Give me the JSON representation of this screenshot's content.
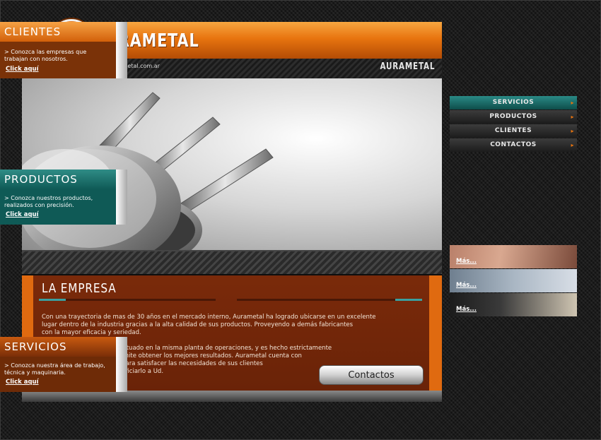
{
  "header": {
    "logo_letter": "A",
    "logo_text": "AURAMETAL",
    "url": "www.aurametal.com.ar",
    "brand_small": "AURAMETAL",
    "accent": "#e8740f"
  },
  "empresa": {
    "title": "LA EMPRESA",
    "para1": "Con una trayectoria de mas de 30 años en el mercado interno, Aurametal ha logrado ubicarse en un excelente\nlugar dentro de la industria gracias a la alta calidad de sus productos. Proveyendo a demás fabricantes\ncon la mayor eficacia y seriedad.",
    "para2": "El control de calidad es efectuado en la misma planta de operaciones, y es hecho estrictamente\npor sus dueños, lo cual permite obtener los mejores resultados. Aurametal cuenta con\nun personal especializado para satisfacer las necesidades de sus clientes\ny está preparada para beneficiarlo a Ud.\nen un futuro cercano.",
    "contact_button": "Contactos"
  },
  "sidebar": {
    "clientes": {
      "title": "CLIENTES",
      "text": "> Conozca las empresas que trabajan con nosotros.",
      "link": "Click aquí"
    },
    "nav": [
      {
        "label": "SERVICIOS",
        "active": true
      },
      {
        "label": "PRODUCTOS",
        "active": false
      },
      {
        "label": "CLIENTES",
        "active": false
      },
      {
        "label": "CONTACTOS",
        "active": false
      }
    ],
    "productos": {
      "title": "PRODUCTOS",
      "text": "> Conozca nuestros productos, realizados con precisión.",
      "link": "Click aquí"
    },
    "gallery": [
      "Más...",
      "Más...",
      "Más..."
    ],
    "servicios": {
      "title": "SERVICIOS",
      "text": "> Conozca nuestra área de trabajo, técnica y maquinaria.",
      "link": "Click aquí"
    }
  }
}
